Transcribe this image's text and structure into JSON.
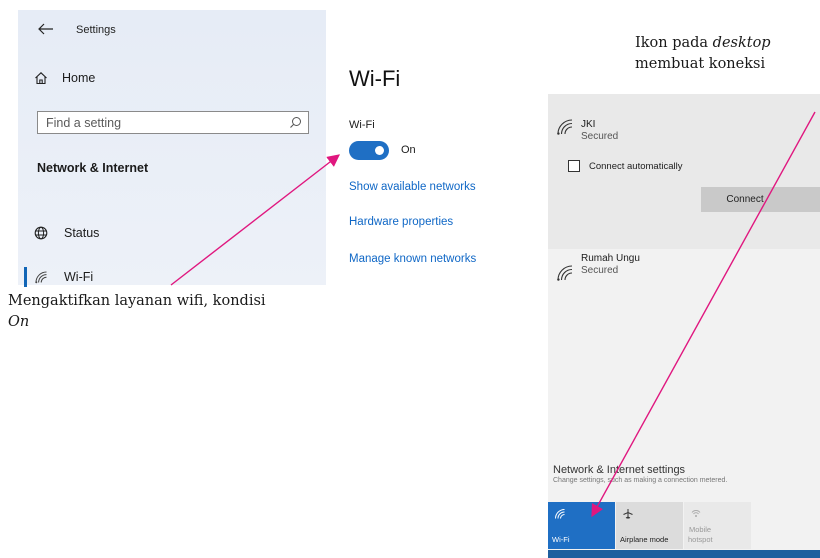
{
  "settings": {
    "title": "Settings",
    "home_label": "Home",
    "search_placeholder": "Find a setting",
    "section_heading": "Network & Internet",
    "nav": [
      {
        "label": "Status",
        "icon": "globe-icon"
      },
      {
        "label": "Wi-Fi",
        "icon": "wifi-icon",
        "active": true
      }
    ],
    "page_heading": "Wi-Fi",
    "wifi_sublabel": "Wi-Fi",
    "toggle_state": "On",
    "toggle_on": true,
    "links": [
      "Show available networks",
      "Hardware properties",
      "Manage known networks"
    ],
    "accent_color": "#1f6fc4"
  },
  "annotations": {
    "left": {
      "text": "Mengaktifkan layanan wifi, kondisi ",
      "italic": "On"
    },
    "right": {
      "line1_prefix": "Ikon pada ",
      "line1_italic": "desktop",
      "line2": "membuat koneksi"
    },
    "arrow_color": "#e0177f"
  },
  "flyout": {
    "networks": [
      {
        "name": "JKI",
        "status": "Secured"
      },
      {
        "name": "Rumah Ungu",
        "status": "Secured"
      }
    ],
    "connect_auto_label": "Connect automatically",
    "connect_button": "Connect",
    "settings_link": "Network & Internet settings",
    "settings_desc": "Change settings, such as making a connection metered.",
    "tiles": [
      {
        "label": "Wi-Fi",
        "icon": "wifi-icon",
        "active": true
      },
      {
        "label": "Airplane mode",
        "icon": "airplane-icon"
      },
      {
        "label": "Mobile hotspot",
        "label_line1": "Mobile",
        "label_line2": "hotspot",
        "icon": "hotspot-icon"
      }
    ]
  }
}
